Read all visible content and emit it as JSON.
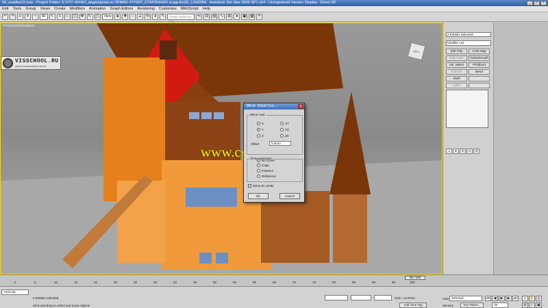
{
  "titlebar": {
    "text": "3d_usadba13.max     - Project Folder: E:\\!!!!!!~ИНФО_видеоуроки по 3DMAX~!!!!!\\007_СТАРИННАЯ усадьба\\3D_USADBA   - Autodesk 3ds Max 2009 SP1  x64   - Unregistered Version        Display : Direct 3D"
  },
  "menu": {
    "items": [
      "Edit",
      "Tools",
      "Group",
      "Views",
      "Create",
      "Modifiers",
      "Animation",
      "Graph Editors",
      "Rendering",
      "Customize",
      "MAXScript",
      "Help"
    ]
  },
  "toolbar": {
    "filter_value": "All",
    "view_value": "View",
    "named_selection_placeholder": "Create Selection Set"
  },
  "viewport": {
    "label": "Perspective/Enabled",
    "logo_text": "VISSCHOOL.RU",
    "logo_subtext": "школа визуализации школы",
    "viewcube_label": "LEFT",
    "watermark": "www.cgtsj.com"
  },
  "dialog": {
    "title": "Mirror: World Coo...",
    "close_glyph": "×",
    "mirror_axis_label": "Mirror Axis:",
    "axes": [
      "X",
      "Y",
      "Z",
      "XY",
      "YZ",
      "ZX"
    ],
    "selected_axis": "Y",
    "offset_label": "Offset:",
    "offset_value": "0.0mm",
    "clone_label": "Clone Selection:",
    "clone_options": [
      "No Clone",
      "Copy",
      "Instance",
      "Reference"
    ],
    "mirror_ik_label": "Mirror IK Limits",
    "mirror_ik_checked": true,
    "ok_label": "OK",
    "cancel_label": "Cancel"
  },
  "command_panel": {
    "selection_name": "2 Entities Selected",
    "modifier_list": "Modifier List",
    "buttons": [
      {
        "label": "Edit Poly",
        "disabled": false
      },
      {
        "label": "UVW Map",
        "disabled": false
      },
      {
        "label": "Edit Patch",
        "disabled": true
      },
      {
        "label": "TurboSmooth",
        "disabled": false
      },
      {
        "label": "Vol. Select",
        "disabled": false
      },
      {
        "label": "FFD(box)",
        "disabled": false
      },
      {
        "label": "Extrude",
        "disabled": true
      },
      {
        "label": "Bend",
        "disabled": false
      },
      {
        "label": "Shell",
        "disabled": false
      },
      {
        "label": "",
        "disabled": true
      },
      {
        "label": "Lathe",
        "disabled": true
      },
      {
        "label": "",
        "disabled": true
      }
    ]
  },
  "timeline": {
    "slider_label": "39 / 100",
    "ticks": [
      "0",
      "5",
      "10",
      "15",
      "20",
      "25",
      "30",
      "35",
      "40",
      "45",
      "50",
      "55",
      "60",
      "65",
      "70",
      "75",
      "80",
      "85",
      "90",
      "95",
      "100"
    ]
  },
  "status": {
    "maxscript_prompt": "AXScript.",
    "selection_status": "2 Entities Selected",
    "prompt": "Click and drag to select and move objects",
    "grid": "Grid = 10.0mm",
    "add_time_tag": "Add Time Tag",
    "auto_key": "Auto Key",
    "set_key": "Set Key",
    "selected_value": "Selected",
    "key_filters": "Key Filters...",
    "frame_value": "39"
  }
}
